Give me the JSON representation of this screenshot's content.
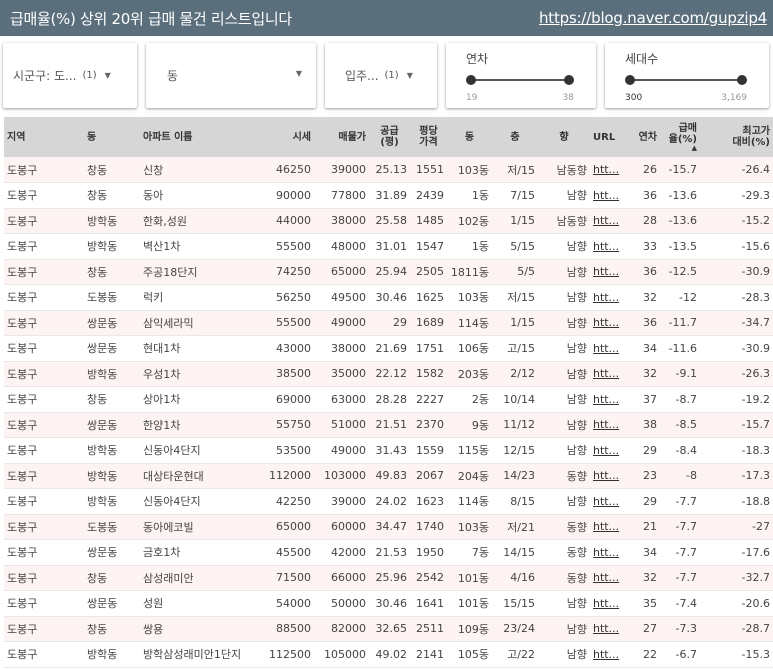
{
  "header": {
    "title": "급매율(%) 상위 20위 급매 물건 리스트입니다",
    "link": "https://blog.naver.com/gupzip4"
  },
  "filters": {
    "sigungu": {
      "label": "시군구: 도...",
      "count": "(1)",
      "caret": "▼"
    },
    "dong": {
      "label": "동",
      "caret": "▼"
    },
    "ipju": {
      "label": "입주...",
      "count": "(1)",
      "caret": "▼"
    },
    "year": {
      "label": "연차",
      "min": "19",
      "max": "38"
    },
    "households": {
      "label": "세대수",
      "min": "300",
      "max": "3,169"
    }
  },
  "table": {
    "headers": {
      "region": "지역",
      "dong": "동",
      "apt": "아파트 이름",
      "price": "시세",
      "listing": "매물가",
      "supply1": "공급",
      "supply2": "(평)",
      "pyeong1": "평당",
      "pyeong2": "가격",
      "building": "동",
      "floor": "층",
      "direction": "향",
      "url": "URL",
      "age": "연차",
      "rate1": "급매",
      "rate2": "율(%)",
      "high1": "최고가",
      "high2": "대비(%)",
      "sort_arrow": "▲"
    },
    "rows": [
      [
        "도봉구",
        "창동",
        "신창",
        "46250",
        "39000",
        "25.13",
        "1551",
        "103동",
        "저/15",
        "남동향",
        "htt...",
        "26",
        "-15.7",
        "-26.4"
      ],
      [
        "도봉구",
        "창동",
        "동아",
        "90000",
        "77800",
        "31.89",
        "2439",
        "1동",
        "7/15",
        "남향",
        "htt...",
        "36",
        "-13.6",
        "-29.3"
      ],
      [
        "도봉구",
        "방학동",
        "한화,성원",
        "44000",
        "38000",
        "25.58",
        "1485",
        "102동",
        "1/15",
        "남동향",
        "htt...",
        "28",
        "-13.6",
        "-15.2"
      ],
      [
        "도봉구",
        "방학동",
        "벽산1차",
        "55500",
        "48000",
        "31.01",
        "1547",
        "1동",
        "5/15",
        "남향",
        "htt...",
        "33",
        "-13.5",
        "-15.6"
      ],
      [
        "도봉구",
        "창동",
        "주공18단지",
        "74250",
        "65000",
        "25.94",
        "2505",
        "1811동",
        "5/5",
        "남향",
        "htt...",
        "36",
        "-12.5",
        "-30.9"
      ],
      [
        "도봉구",
        "도봉동",
        "럭키",
        "56250",
        "49500",
        "30.46",
        "1625",
        "103동",
        "저/15",
        "남향",
        "htt...",
        "32",
        "-12",
        "-28.3"
      ],
      [
        "도봉구",
        "쌍문동",
        "삼익세라믹",
        "55500",
        "49000",
        "29",
        "1689",
        "114동",
        "1/15",
        "남향",
        "htt...",
        "36",
        "-11.7",
        "-34.7"
      ],
      [
        "도봉구",
        "쌍문동",
        "현대1차",
        "43000",
        "38000",
        "21.69",
        "1751",
        "106동",
        "고/15",
        "남향",
        "htt...",
        "34",
        "-11.6",
        "-30.9"
      ],
      [
        "도봉구",
        "방학동",
        "우성1차",
        "38500",
        "35000",
        "22.12",
        "1582",
        "203동",
        "2/12",
        "남향",
        "htt...",
        "32",
        "-9.1",
        "-26.3"
      ],
      [
        "도봉구",
        "창동",
        "상아1차",
        "69000",
        "63000",
        "28.28",
        "2227",
        "2동",
        "10/14",
        "남향",
        "htt...",
        "37",
        "-8.7",
        "-19.2"
      ],
      [
        "도봉구",
        "쌍문동",
        "한양1차",
        "55750",
        "51000",
        "21.51",
        "2370",
        "9동",
        "11/12",
        "남향",
        "htt...",
        "38",
        "-8.5",
        "-15.7"
      ],
      [
        "도봉구",
        "방학동",
        "신동아4단지",
        "53500",
        "49000",
        "31.43",
        "1559",
        "115동",
        "12/15",
        "남향",
        "htt...",
        "29",
        "-8.4",
        "-18.3"
      ],
      [
        "도봉구",
        "방학동",
        "대상타운현대",
        "112000",
        "103000",
        "49.83",
        "2067",
        "204동",
        "14/23",
        "동향",
        "htt...",
        "23",
        "-8",
        "-17.3"
      ],
      [
        "도봉구",
        "방학동",
        "신동아4단지",
        "42250",
        "39000",
        "24.02",
        "1623",
        "114동",
        "8/15",
        "남향",
        "htt...",
        "29",
        "-7.7",
        "-18.8"
      ],
      [
        "도봉구",
        "도봉동",
        "동아에코빌",
        "65000",
        "60000",
        "34.47",
        "1740",
        "103동",
        "저/21",
        "동향",
        "htt...",
        "21",
        "-7.7",
        "-27"
      ],
      [
        "도봉구",
        "쌍문동",
        "금호1차",
        "45500",
        "42000",
        "21.53",
        "1950",
        "7동",
        "14/15",
        "동향",
        "htt...",
        "34",
        "-7.7",
        "-17.6"
      ],
      [
        "도봉구",
        "창동",
        "삼성래미안",
        "71500",
        "66000",
        "25.96",
        "2542",
        "101동",
        "4/16",
        "동향",
        "htt...",
        "32",
        "-7.7",
        "-32.7"
      ],
      [
        "도봉구",
        "쌍문동",
        "성원",
        "54000",
        "50000",
        "30.46",
        "1641",
        "101동",
        "15/15",
        "남향",
        "htt...",
        "35",
        "-7.4",
        "-20.6"
      ],
      [
        "도봉구",
        "창동",
        "쌍용",
        "88500",
        "82000",
        "32.65",
        "2511",
        "109동",
        "23/24",
        "남향",
        "htt...",
        "27",
        "-7.3",
        "-28.7"
      ],
      [
        "도봉구",
        "방학동",
        "방학삼성래미안1단지",
        "112500",
        "105000",
        "49.02",
        "2141",
        "105동",
        "고/22",
        "남향",
        "htt...",
        "22",
        "-6.7",
        "-15.3"
      ]
    ]
  }
}
